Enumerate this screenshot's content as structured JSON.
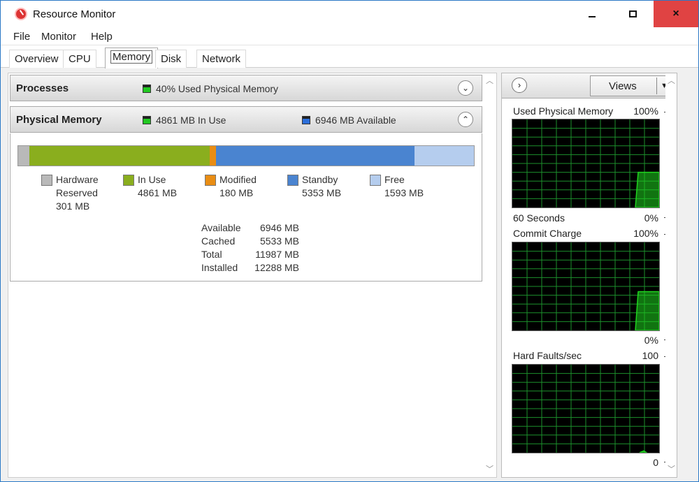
{
  "window": {
    "title": "Resource Monitor",
    "controls": {
      "minimize": "",
      "maximize": "",
      "close": "×"
    }
  },
  "menu": [
    {
      "label": "File"
    },
    {
      "label": "Monitor"
    },
    {
      "label": "Help"
    }
  ],
  "tabs": [
    {
      "label": "Overview",
      "active": false
    },
    {
      "label": "CPU",
      "active": false
    },
    {
      "label": "Memory",
      "active": true
    },
    {
      "label": "Disk",
      "active": false
    },
    {
      "label": "Network",
      "active": false
    }
  ],
  "processes_section": {
    "title": "Processes",
    "stat": "40% Used Physical Memory",
    "stat_color": "#22c922",
    "expanded": false
  },
  "physical_memory": {
    "title": "Physical Memory",
    "in_use_stat": "4861 MB In Use",
    "available_stat": "6946 MB Available",
    "expanded": true,
    "bar_total_mb": 12288,
    "segments": [
      {
        "key": "hardware",
        "label": "Hardware Reserved",
        "label_line1": "Hardware",
        "label_line2": "Reserved",
        "value": "301 MB",
        "mb": 301,
        "color": "#b9b9b9"
      },
      {
        "key": "inuse",
        "label": "In Use",
        "value": "4861 MB",
        "mb": 4861,
        "color": "#8aae1e"
      },
      {
        "key": "modified",
        "label": "Modified",
        "value": "180 MB",
        "mb": 180,
        "color": "#e98d14"
      },
      {
        "key": "standby",
        "label": "Standby",
        "value": "5353 MB",
        "mb": 5353,
        "color": "#4a84d0"
      },
      {
        "key": "free",
        "label": "Free",
        "value": "1593 MB",
        "mb": 1593,
        "color": "#b5cdee"
      }
    ],
    "summary": [
      {
        "label": "Available",
        "value": "6946 MB"
      },
      {
        "label": "Cached",
        "value": "5533 MB"
      },
      {
        "label": "Total",
        "value": "11987 MB"
      },
      {
        "label": "Installed",
        "value": "12288 MB"
      }
    ]
  },
  "right_panel": {
    "views_label": "Views",
    "graphs": [
      {
        "title": "Used Physical Memory",
        "max": "100%",
        "footer_left": "60 Seconds",
        "footer_right": "0%",
        "recent_level": 0.4
      },
      {
        "title": "Commit Charge",
        "max": "100%",
        "footer_left": "",
        "footer_right": "0%",
        "recent_level": 0.44
      },
      {
        "title": "Hard Faults/sec",
        "max": "100",
        "footer_left": "",
        "footer_right": "0",
        "recent_level": 0.02
      }
    ],
    "grid_color": "#1c8f2c",
    "fill_color": "#1fd31f"
  }
}
